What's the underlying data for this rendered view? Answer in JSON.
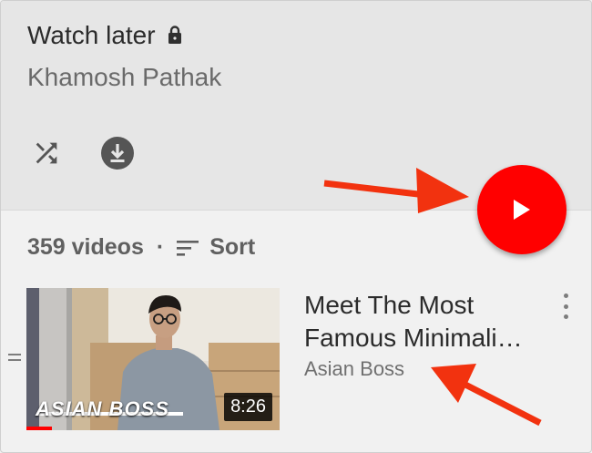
{
  "playlist": {
    "title": "Watch later",
    "owner": "Khamosh Pathak",
    "video_count_label": "359 videos",
    "separator": "·",
    "sort_label": "Sort"
  },
  "icons": {
    "lock": "lock-icon",
    "shuffle": "shuffle-icon",
    "download": "download-icon",
    "play": "play-icon",
    "sort": "sort-icon",
    "more": "more-vert-icon"
  },
  "video": {
    "title_line_1": "Meet The Most",
    "title_line_2": "Famous Minimali…",
    "channel": "Asian Boss",
    "duration": "8:26",
    "thumbnail_brand": "ASIAN BOSS"
  },
  "colors": {
    "accent": "#ff0000",
    "annotation_arrow": "#f2320f"
  }
}
